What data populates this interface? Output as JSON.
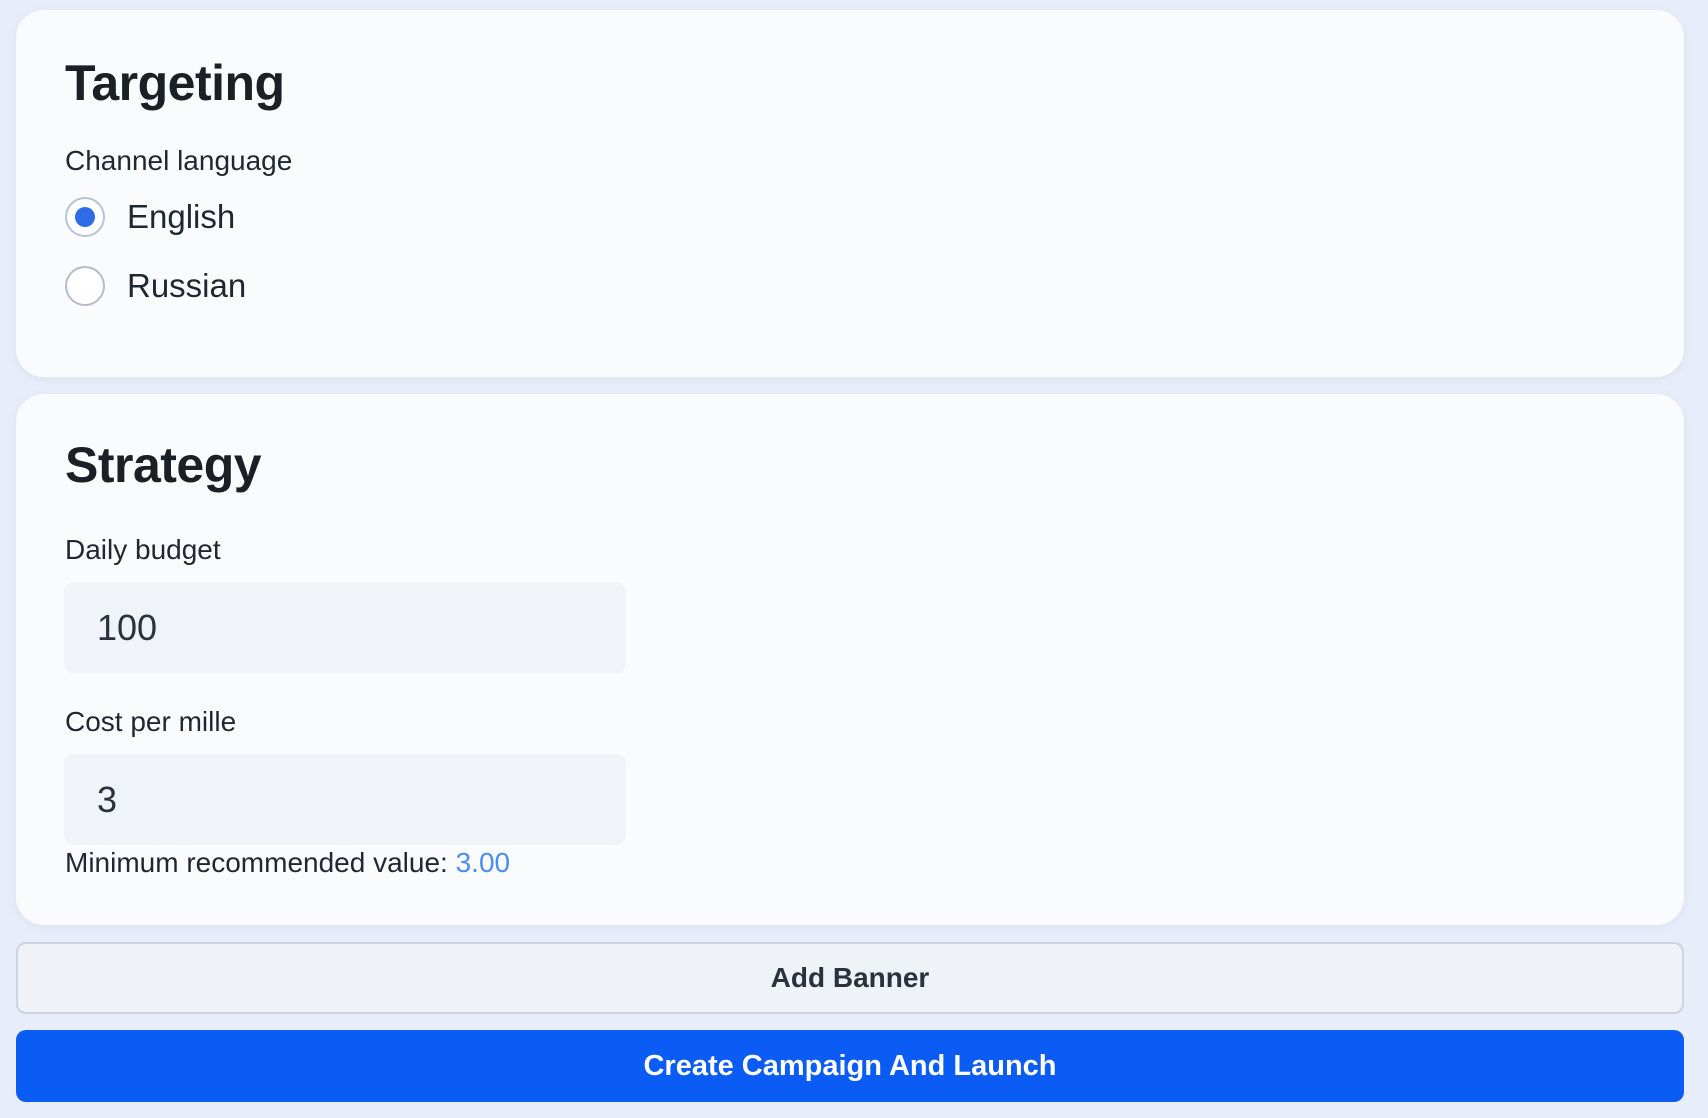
{
  "targeting": {
    "title": "Targeting",
    "channel_language_label": "Channel language",
    "options": [
      {
        "label": "English",
        "selected": true
      },
      {
        "label": "Russian",
        "selected": false
      }
    ]
  },
  "strategy": {
    "title": "Strategy",
    "daily_budget": {
      "label": "Daily budget",
      "value": "100"
    },
    "cost_per_mille": {
      "label": "Cost per mille",
      "value": "3"
    },
    "hint": {
      "prefix": "Minimum recommended value:",
      "value": "3.00"
    }
  },
  "actions": {
    "add_banner_label": "Add Banner",
    "create_launch_label": "Create Campaign And Launch"
  },
  "colors": {
    "accent": "#0b5cf5",
    "radio_selected": "#2e6be6",
    "hint_value": "#4a8ef0",
    "page_background": "#e8eef9",
    "card_background": "#f9fbfd"
  }
}
